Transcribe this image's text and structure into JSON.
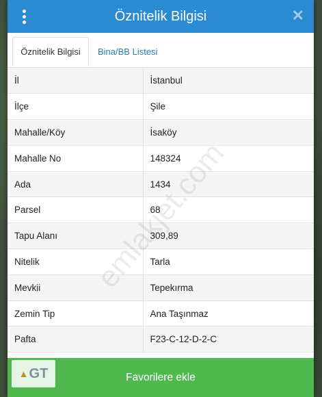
{
  "dialog": {
    "title": "Öznitelik Bilgisi",
    "close_glyph": "✕"
  },
  "tabs": [
    {
      "label": "Öznitelik Bilgisi",
      "active": true
    },
    {
      "label": "Bina/BB Listesi",
      "active": false
    }
  ],
  "rows": [
    {
      "key": "İl",
      "value": "İstanbul"
    },
    {
      "key": "İlçe",
      "value": "Şile"
    },
    {
      "key": "Mahalle/Köy",
      "value": "İsaköy"
    },
    {
      "key": "Mahalle No",
      "value": "148324"
    },
    {
      "key": "Ada",
      "value": "1434"
    },
    {
      "key": "Parsel",
      "value": "68"
    },
    {
      "key": "Tapu Alanı",
      "value": "309,89"
    },
    {
      "key": "Nitelik",
      "value": "Tarla"
    },
    {
      "key": "Mevkii",
      "value": "Tepekırma"
    },
    {
      "key": "Zemin Tip",
      "value": "Ana Taşınmaz"
    },
    {
      "key": "Pafta",
      "value": "F23-C-12-D-2-C"
    }
  ],
  "watermark": "emlakjet.com",
  "logo_text": "GT",
  "footer": {
    "favorite_label": "Favorilere ekle"
  },
  "colors": {
    "header": "#2a8ad2",
    "favorite_button": "#4fb84f",
    "tab_link": "#2a7ab8"
  }
}
